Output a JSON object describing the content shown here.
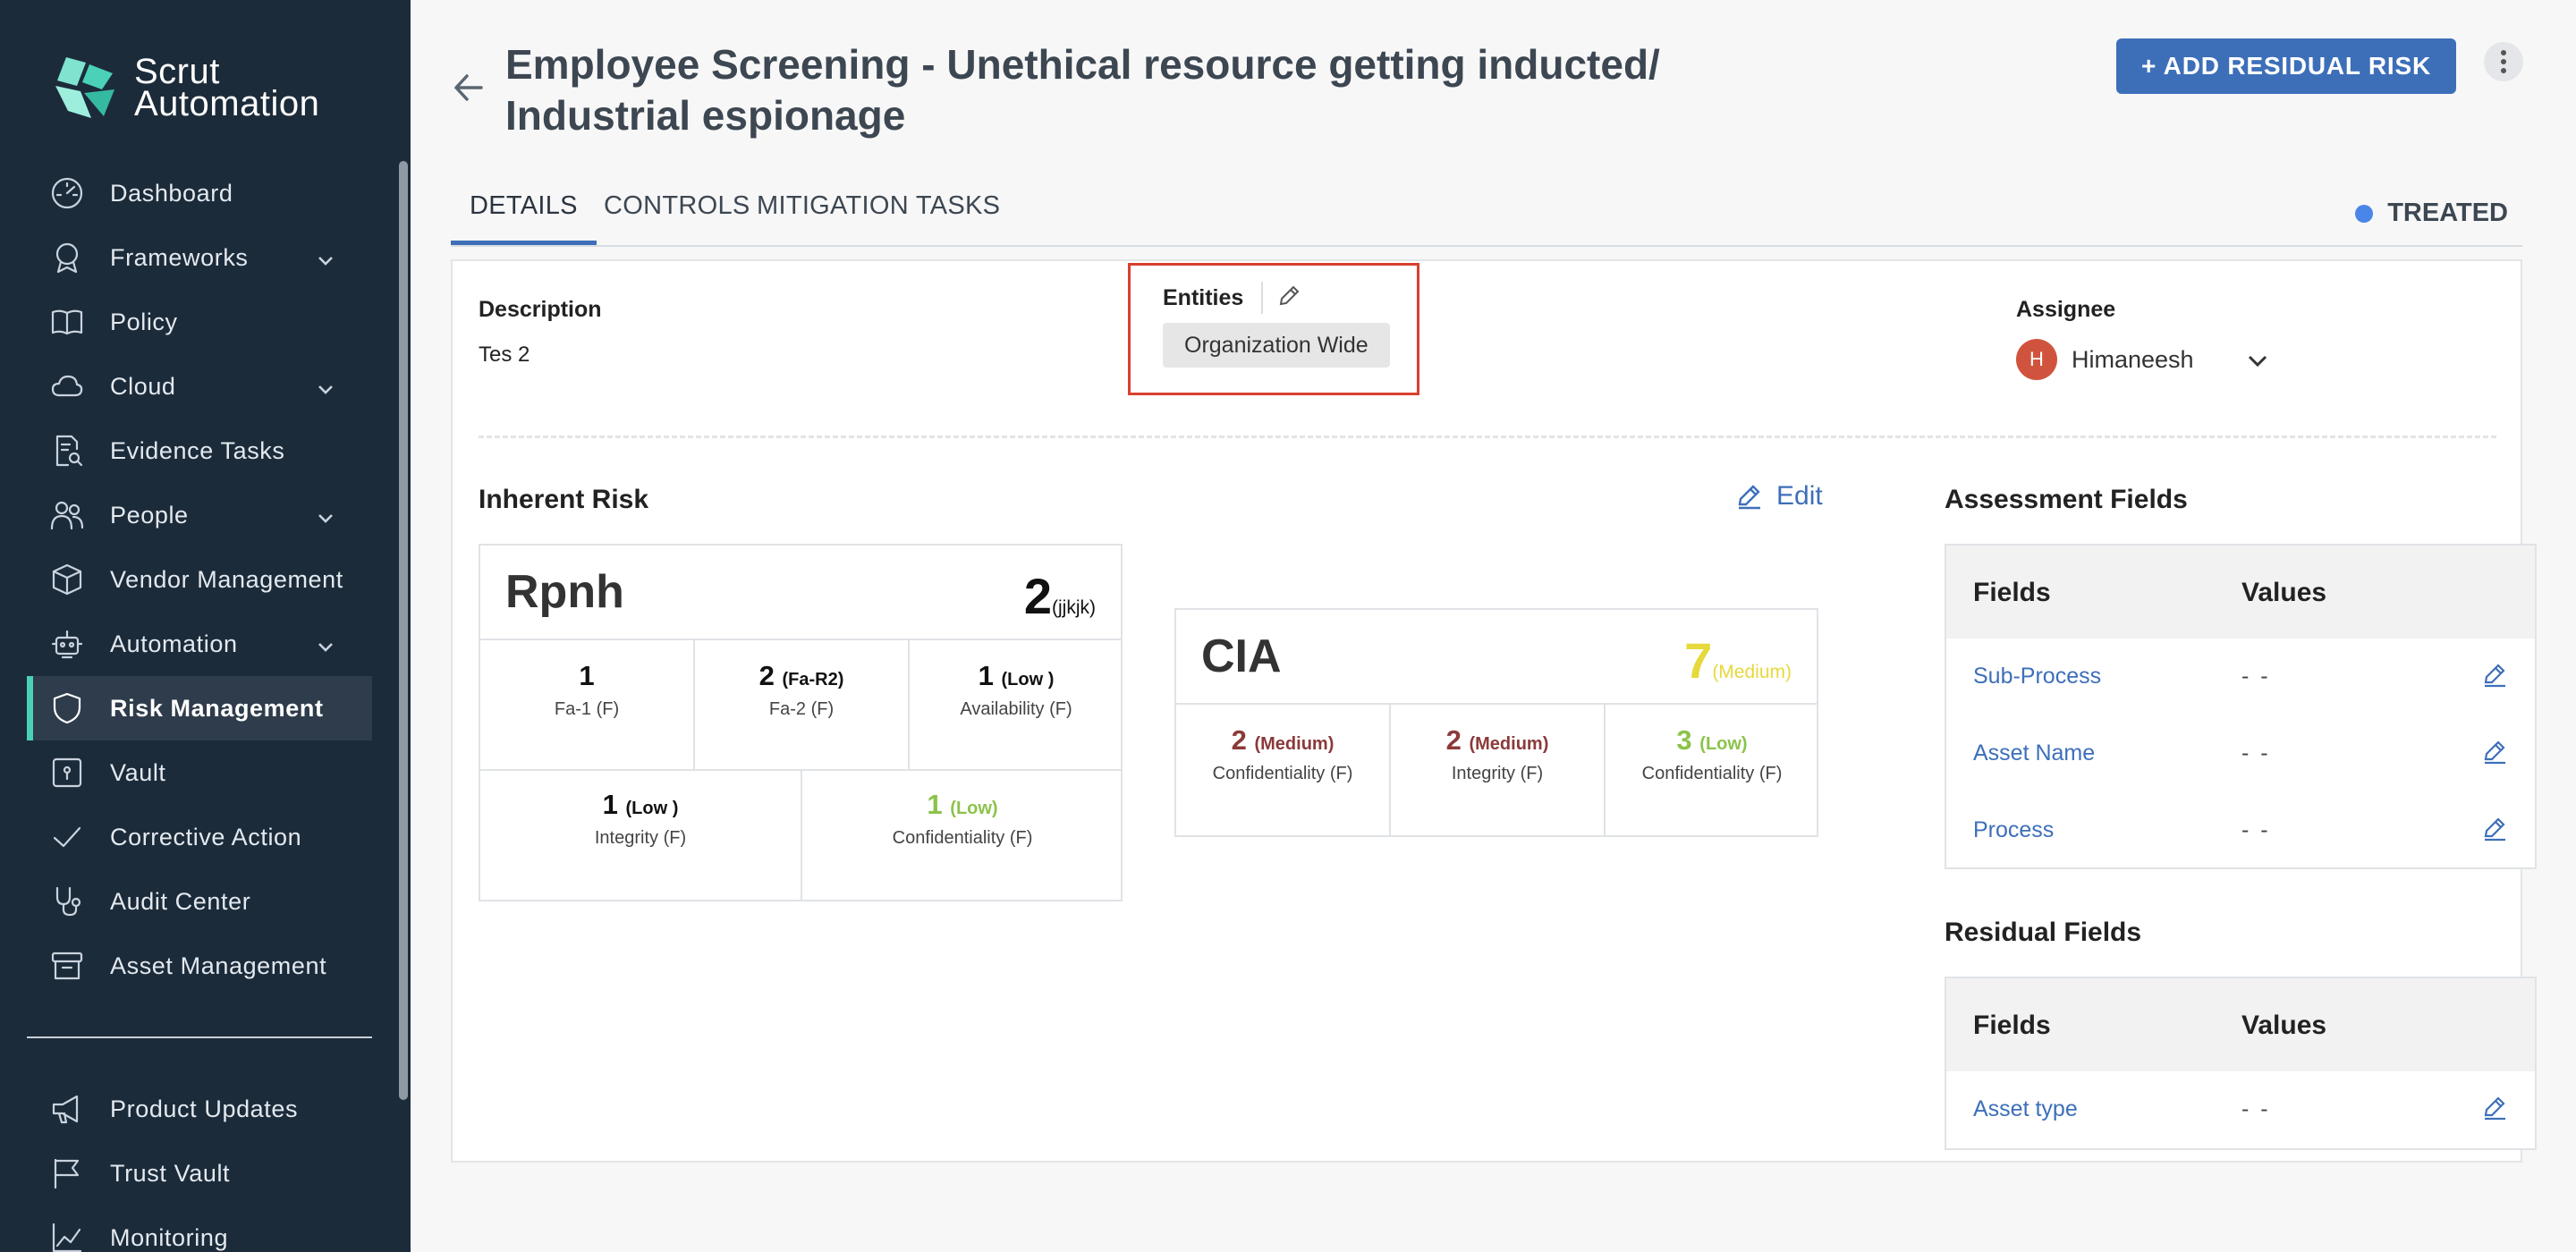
{
  "brand": {
    "line1": "Scrut",
    "line2": "Automation"
  },
  "sidebar": {
    "items": [
      {
        "label": "Dashboard",
        "icon": "dashboard-icon"
      },
      {
        "label": "Frameworks",
        "icon": "award-icon"
      },
      {
        "label": "Policy",
        "icon": "book-icon"
      },
      {
        "label": "Cloud",
        "icon": "cloud-icon"
      },
      {
        "label": "Evidence Tasks",
        "icon": "evidence-icon"
      },
      {
        "label": "People",
        "icon": "people-icon"
      },
      {
        "label": "Vendor Management",
        "icon": "box-icon"
      },
      {
        "label": "Automation",
        "icon": "robot-icon"
      },
      {
        "label": "Risk Management",
        "icon": "shield-icon"
      },
      {
        "label": "Vault",
        "icon": "vault-icon"
      },
      {
        "label": "Corrective Action",
        "icon": "check-icon"
      },
      {
        "label": "Audit Center",
        "icon": "stethoscope-icon"
      },
      {
        "label": "Asset Management",
        "icon": "archive-icon"
      }
    ],
    "bottom_items": [
      {
        "label": "Product Updates",
        "icon": "megaphone-icon"
      },
      {
        "label": "Trust Vault",
        "icon": "flag-icon"
      },
      {
        "label": "Monitoring",
        "icon": "chart-icon"
      }
    ]
  },
  "header": {
    "title": "Employee Screening - Unethical resource getting inducted/ Industrial espionage",
    "add_button": "+ ADD RESIDUAL RISK"
  },
  "tabs": [
    "DETAILS",
    "CONTROLS",
    "MITIGATION TASKS"
  ],
  "status": {
    "label": "TREATED",
    "color": "#4a86e8"
  },
  "details": {
    "description_label": "Description",
    "description_value": "Tes 2",
    "entities_label": "Entities",
    "entity_chip": "Organization Wide",
    "assignee_label": "Assignee",
    "assignee_initial": "H",
    "assignee_name": "Himaneesh"
  },
  "inherent_risk": {
    "title": "Inherent Risk",
    "edit_label": "Edit",
    "rpnh": {
      "name": "Rpnh",
      "score": "2",
      "score_label": "(jjkjk)",
      "cells": [
        {
          "value": "1",
          "tag": "",
          "name": "Fa-1 (F)"
        },
        {
          "value": "2",
          "tag": "(Fa-R2)",
          "name": "Fa-2 (F)"
        },
        {
          "value": "1",
          "tag": "(Low )",
          "name": "Availability (F)"
        },
        {
          "value": "1",
          "tag": "(Low )",
          "name": "Integrity (F)"
        },
        {
          "value": "1",
          "tag": "(Low)",
          "name": "Confidentiality (F)"
        }
      ]
    },
    "cia": {
      "name": "CIA",
      "score": "7",
      "score_label": "(Medium)",
      "cells": [
        {
          "value": "2",
          "tag": "(Medium)",
          "name": "Confidentiality (F)"
        },
        {
          "value": "2",
          "tag": "(Medium)",
          "name": "Integrity (F)"
        },
        {
          "value": "3",
          "tag": "(Low)",
          "name": "Confidentiality (F)"
        }
      ]
    }
  },
  "assessment_fields": {
    "title": "Assessment Fields",
    "col_fields": "Fields",
    "col_values": "Values",
    "rows": [
      {
        "field": "Sub-Process",
        "value": "- -"
      },
      {
        "field": "Asset Name",
        "value": "- -"
      },
      {
        "field": "Process",
        "value": "- -"
      }
    ]
  },
  "residual_fields": {
    "title": "Residual Fields",
    "col_fields": "Fields",
    "col_values": "Values",
    "rows": [
      {
        "field": "Asset type",
        "value": "- -"
      }
    ]
  },
  "colors": {
    "sidebar_bg": "#1c2b3a",
    "accent": "#3d6fb9",
    "active_indicator": "#4ad1b8",
    "medium": "#8b3a3a",
    "low_green": "#8bc34a",
    "medium_yellow": "#e6d93c"
  }
}
